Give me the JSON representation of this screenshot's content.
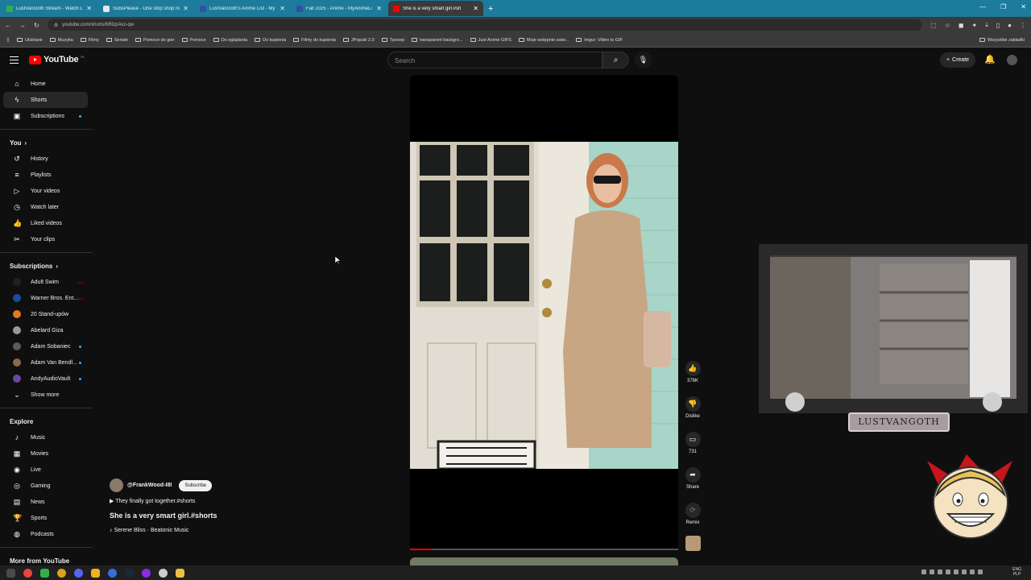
{
  "browser": {
    "tabs": [
      {
        "title": "LustVanGoth Stream - Watch L",
        "color": "#2db34a",
        "active": false
      },
      {
        "title": "SubsPlease - One stop shop fo",
        "color": "#e6e6e6",
        "active": false
      },
      {
        "title": "LustVanGoth's Anime List - My",
        "color": "#2e51a2",
        "active": false
      },
      {
        "title": "Fall 2025 - Anime - MyAnimeLi",
        "color": "#2e51a2",
        "active": false
      },
      {
        "title": "She is a very smart girl.#sh",
        "color": "#ff0000",
        "active": true
      }
    ],
    "new_tab": "+",
    "url": "youtube.com/shorts/6RlzpAvz-qw",
    "bookmarks": [
      "Ulubiane",
      "Muzyka",
      "Filmy",
      "Seriale",
      "Pomoce do gier",
      "Pomoce",
      "Do oglądania",
      "Do kupienia",
      "Filmy do kupienia",
      "JPopuki 2.0",
      "Tpexep",
      "transparent backgro...",
      "Just Anime GIFS",
      "Moje wstępnie zatw...",
      "Imgur: Video to GIF"
    ],
    "bookmarks_right": "Wszystkie zakładki"
  },
  "masthead": {
    "logo_text": "YouTube",
    "country": "PL",
    "search_placeholder": "Search",
    "create_label": "Create"
  },
  "sidebar": {
    "main": [
      {
        "label": "Home",
        "icon": "⌂"
      },
      {
        "label": "Shorts",
        "icon": "ϟ",
        "active": true
      },
      {
        "label": "Subscriptions",
        "icon": "▣",
        "dot": true
      }
    ],
    "you_header": "You",
    "you": [
      {
        "label": "History",
        "icon": "↺"
      },
      {
        "label": "Playlists",
        "icon": "≡"
      },
      {
        "label": "Your videos",
        "icon": "▷"
      },
      {
        "label": "Watch later",
        "icon": "◷"
      },
      {
        "label": "Liked videos",
        "icon": "👍"
      },
      {
        "label": "Your clips",
        "icon": "✂"
      }
    ],
    "subs_header": "Subscriptions",
    "subs": [
      {
        "label": "Adult Swim",
        "color": "#222",
        "badge": "live"
      },
      {
        "label": "Warner Bros. Ent...",
        "color": "#1a4ea3",
        "badge": "live"
      },
      {
        "label": "20 Stand-upów",
        "color": "#e07a20",
        "badge": ""
      },
      {
        "label": "Abelard Giza",
        "color": "#999",
        "badge": ""
      },
      {
        "label": "Adam Sobaniec",
        "color": "#5a5a5a",
        "badge": "dot"
      },
      {
        "label": "Adam Van Bendl...",
        "color": "#8a6a4a",
        "badge": "dot"
      },
      {
        "label": "AndyAudioVault",
        "color": "#6a4aa0",
        "badge": "dot"
      }
    ],
    "show_more": "Show more",
    "explore_header": "Explore",
    "explore": [
      {
        "label": "Music",
        "icon": "♪"
      },
      {
        "label": "Movies",
        "icon": "▦"
      },
      {
        "label": "Live",
        "icon": "◉"
      },
      {
        "label": "Gaming",
        "icon": "◎"
      },
      {
        "label": "News",
        "icon": "▤"
      },
      {
        "label": "Sports",
        "icon": "🏆"
      },
      {
        "label": "Podcasts",
        "icon": "◍"
      }
    ],
    "more_header": "More from YouTube"
  },
  "short": {
    "channel": "@FrankWood-I8I",
    "subscribe": "Subscribe",
    "description": "▶ They finally got together.#shorts",
    "title": "She is a very smart girl.#shorts",
    "music": "♪ Serene Bliss · Beatonic Music",
    "progress": 0.08
  },
  "actions": {
    "likes": "378K",
    "dislike": "Dislike",
    "comments": "731",
    "share": "Share",
    "remix": "Remix"
  },
  "overlay": {
    "cam_label": "LUSTVANGOTH"
  },
  "taskbar": {
    "lang": "ENG",
    "layout": "PLP"
  }
}
